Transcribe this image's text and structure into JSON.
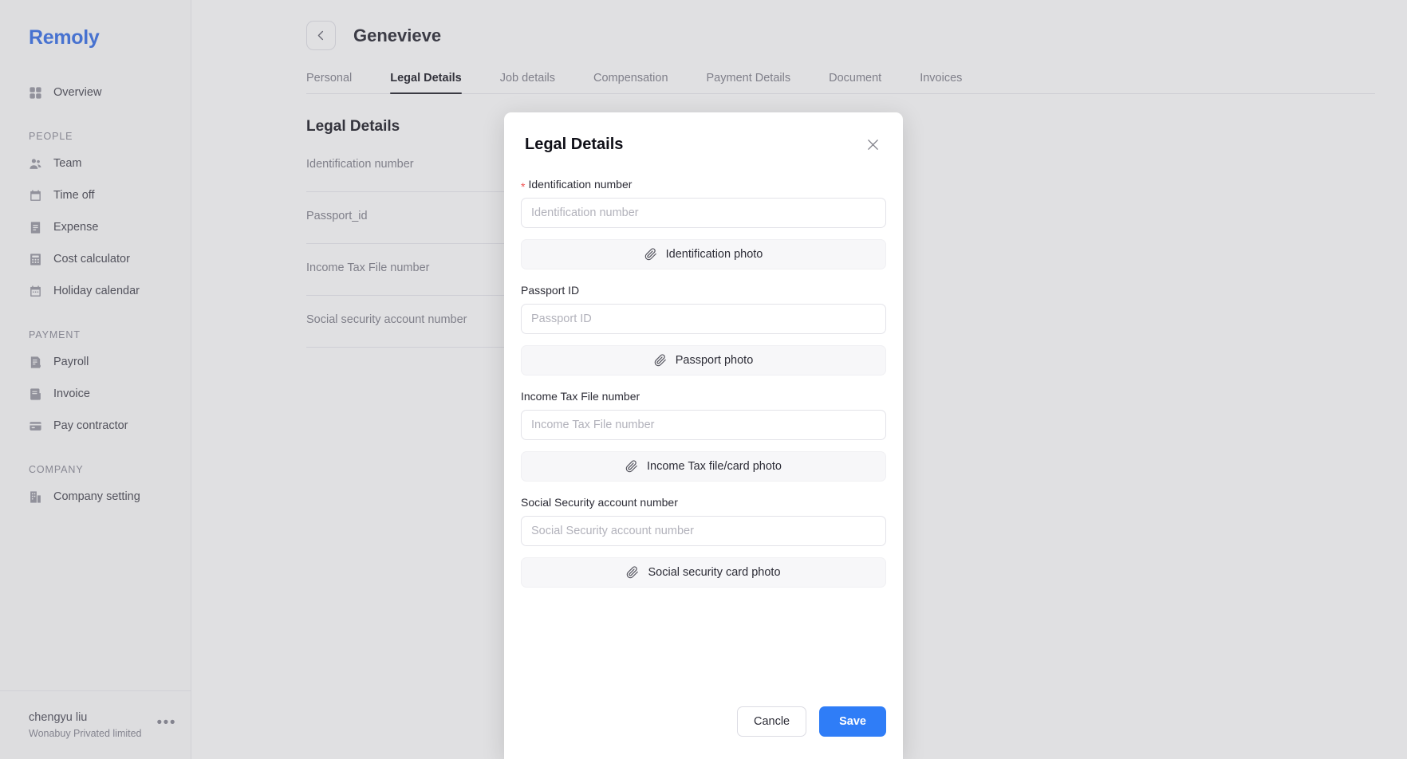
{
  "sidebar": {
    "brand": "Remoly",
    "groups": [
      {
        "label": "",
        "items": [
          {
            "label": "Overview",
            "icon": "grid-icon"
          }
        ]
      },
      {
        "label": "PEOPLE",
        "items": [
          {
            "label": "Team",
            "icon": "team-icon"
          },
          {
            "label": "Time off",
            "icon": "calendar-check-icon"
          },
          {
            "label": "Expense",
            "icon": "receipt-icon"
          },
          {
            "label": "Cost calculator",
            "icon": "calculator-icon"
          },
          {
            "label": "Holiday calendar",
            "icon": "calendar-icon"
          }
        ]
      },
      {
        "label": "PAYMENT",
        "items": [
          {
            "label": "Payroll",
            "icon": "payroll-icon"
          },
          {
            "label": "Invoice",
            "icon": "invoice-icon"
          },
          {
            "label": "Pay contractor",
            "icon": "card-icon"
          }
        ]
      },
      {
        "label": "COMPANY",
        "items": [
          {
            "label": "Company setting",
            "icon": "building-icon"
          }
        ]
      }
    ],
    "footer": {
      "name": "chengyu liu",
      "org": "Wonabuy Privated limited",
      "more": "•••"
    }
  },
  "topbar": {
    "back_icon": "chevron-left-icon",
    "title": "Genevieve"
  },
  "tabs": [
    {
      "label": "Personal",
      "active": false
    },
    {
      "label": "Legal Details",
      "active": true
    },
    {
      "label": "Job details",
      "active": false
    },
    {
      "label": "Compensation",
      "active": false
    },
    {
      "label": "Payment Details",
      "active": false
    },
    {
      "label": "Document",
      "active": false
    },
    {
      "label": "Invoices",
      "active": false
    }
  ],
  "content": {
    "heading": "Legal Details",
    "rows": [
      {
        "label": "Identification number",
        "value": ""
      },
      {
        "label": "Passport_id",
        "value": ""
      },
      {
        "label": "Income Tax File number",
        "value": ""
      },
      {
        "label": "Social security account number",
        "value": ""
      }
    ]
  },
  "modal": {
    "title": "Legal Details",
    "close_icon": "close-icon",
    "fields": [
      {
        "label": "Identification number",
        "required": true,
        "placeholder": "Identification number",
        "value": "",
        "attach_label": "Identification photo",
        "attach_icon": "paperclip-icon"
      },
      {
        "label": "Passport ID",
        "required": false,
        "placeholder": "Passport ID",
        "value": "",
        "attach_label": "Passport photo",
        "attach_icon": "paperclip-icon"
      },
      {
        "label": "Income Tax File number",
        "required": false,
        "placeholder": "Income Tax File number",
        "value": "",
        "attach_label": "Income Tax file/card photo",
        "attach_icon": "paperclip-icon"
      },
      {
        "label": "Social Security account number",
        "required": false,
        "placeholder": "Social Security account number",
        "value": "",
        "attach_label": "Social security card photo",
        "attach_icon": "paperclip-icon"
      }
    ],
    "cancel_label": "Cancle",
    "save_label": "Save"
  },
  "colors": {
    "brand": "#3b72e8",
    "primary": "#2f7df7",
    "required": "#f05252",
    "tab_active": "#22222b"
  }
}
